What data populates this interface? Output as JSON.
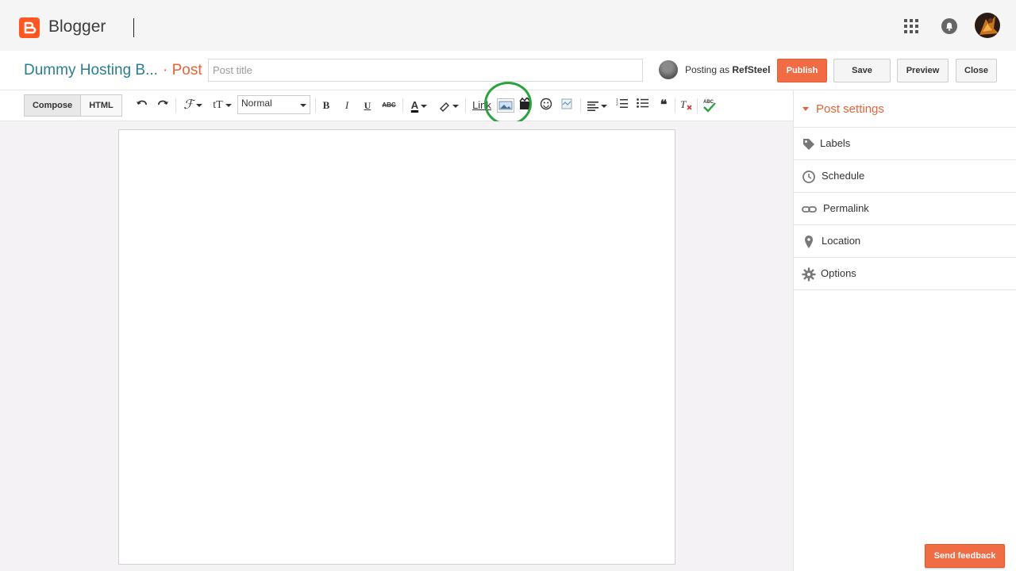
{
  "app": {
    "name": "Blogger"
  },
  "header": {
    "blog_title": "Dummy Hosting B...",
    "crumb": "· Post",
    "post_title_placeholder": "Post title",
    "posting_as_prefix": "Posting as",
    "posting_as_user": "RefSteel",
    "buttons": {
      "publish": "Publish",
      "save": "Save",
      "preview": "Preview",
      "close": "Close"
    }
  },
  "toolbar": {
    "compose": "Compose",
    "html": "HTML",
    "font_size_glyph": "tT",
    "format_value": "Normal",
    "bold": "B",
    "italic": "I",
    "underline": "U",
    "strike": "ABC",
    "text_color": "A",
    "link": "Link",
    "quote": "❝",
    "spellcheck": "ABC"
  },
  "settings": {
    "title": "Post settings",
    "items": [
      {
        "label": "Labels",
        "icon": "tag-icon"
      },
      {
        "label": "Schedule",
        "icon": "clock-icon"
      },
      {
        "label": "Permalink",
        "icon": "link-icon"
      },
      {
        "label": "Location",
        "icon": "location-pin-icon"
      },
      {
        "label": "Options",
        "icon": "gear-icon"
      }
    ]
  },
  "feedback": "Send feedback",
  "colors": {
    "accent": "#f06c45",
    "blog_title": "#2a7d8f",
    "highlight": "#2aa33c"
  }
}
